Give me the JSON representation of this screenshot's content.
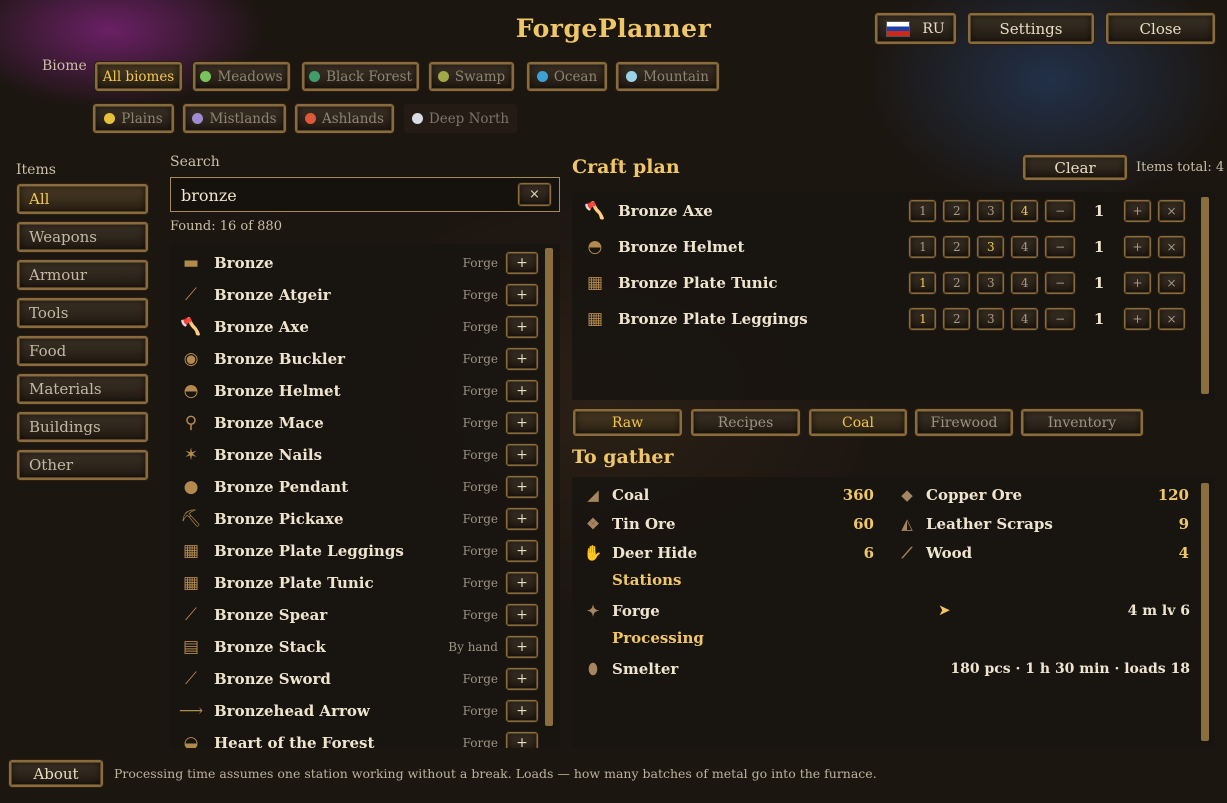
{
  "app": {
    "title": "ForgePlanner"
  },
  "header": {
    "language": "RU",
    "settings": "Settings",
    "close": "Close"
  },
  "biome": {
    "label": "Biome",
    "options": [
      {
        "label": "All biomes",
        "color": ""
      },
      {
        "label": "Meadows",
        "color": "#7ac35a"
      },
      {
        "label": "Black Forest",
        "color": "#3f9e6a"
      },
      {
        "label": "Swamp",
        "color": "#a2a84a"
      },
      {
        "label": "Ocean",
        "color": "#3fa0d6"
      },
      {
        "label": "Mountain",
        "color": "#9cd2e6"
      },
      {
        "label": "Plains",
        "color": "#e8c13a"
      },
      {
        "label": "Mistlands",
        "color": "#a08ad0"
      },
      {
        "label": "Ashlands",
        "color": "#e0583a"
      },
      {
        "label": "Deep North",
        "color": "#d8dde4"
      }
    ]
  },
  "categories": {
    "label": "Items",
    "items": [
      "All",
      "Weapons",
      "Armour",
      "Tools",
      "Food",
      "Materials",
      "Buildings",
      "Other"
    ]
  },
  "search": {
    "label": "Search",
    "value": "bronze",
    "clear": "×",
    "found": "Found: 16 of 880"
  },
  "items": [
    {
      "name": "Bronze",
      "station": "Forge",
      "icon": "ingot-icon",
      "glyph": "▬"
    },
    {
      "name": "Bronze Atgeir",
      "station": "Forge",
      "icon": "atgeir-icon",
      "glyph": "⟋"
    },
    {
      "name": "Bronze Axe",
      "station": "Forge",
      "icon": "axe-icon",
      "glyph": "🪓"
    },
    {
      "name": "Bronze Buckler",
      "station": "Forge",
      "icon": "buckler-icon",
      "glyph": "◉"
    },
    {
      "name": "Bronze Helmet",
      "station": "Forge",
      "icon": "helmet-icon",
      "glyph": "◓"
    },
    {
      "name": "Bronze Mace",
      "station": "Forge",
      "icon": "mace-icon",
      "glyph": "⚲"
    },
    {
      "name": "Bronze Nails",
      "station": "Forge",
      "icon": "nails-icon",
      "glyph": "✶"
    },
    {
      "name": "Bronze Pendant",
      "station": "Forge",
      "icon": "pendant-icon",
      "glyph": "●"
    },
    {
      "name": "Bronze Pickaxe",
      "station": "Forge",
      "icon": "pickaxe-icon",
      "glyph": "⛏"
    },
    {
      "name": "Bronze Plate Leggings",
      "station": "Forge",
      "icon": "leggings-icon",
      "glyph": "▦"
    },
    {
      "name": "Bronze Plate Tunic",
      "station": "Forge",
      "icon": "tunic-icon",
      "glyph": "▦"
    },
    {
      "name": "Bronze Spear",
      "station": "Forge",
      "icon": "spear-icon",
      "glyph": "⟋"
    },
    {
      "name": "Bronze Stack",
      "station": "By hand",
      "icon": "stack-icon",
      "glyph": "▤"
    },
    {
      "name": "Bronze Sword",
      "station": "Forge",
      "icon": "sword-icon",
      "glyph": "⟋"
    },
    {
      "name": "Bronzehead Arrow",
      "station": "Forge",
      "icon": "arrow-icon",
      "glyph": "⟶"
    },
    {
      "name": "Heart of the Forest",
      "station": "Forge",
      "icon": "heart-icon",
      "glyph": "◒"
    }
  ],
  "plan": {
    "title": "Craft plan",
    "clear": "Clear",
    "total": "Items total: 4",
    "rows": [
      {
        "name": "Bronze Axe",
        "icon": "axe-icon",
        "glyph": "🪓",
        "level": 4,
        "qty": "1"
      },
      {
        "name": "Bronze Helmet",
        "icon": "helmet-icon",
        "glyph": "◓",
        "level": 3,
        "qty": "1"
      },
      {
        "name": "Bronze Plate Tunic",
        "icon": "tunic-icon",
        "glyph": "▦",
        "level": 1,
        "qty": "1"
      },
      {
        "name": "Bronze Plate Leggings",
        "icon": "leggings-icon",
        "glyph": "▦",
        "level": 1,
        "qty": "1"
      }
    ],
    "levels": [
      "1",
      "2",
      "3",
      "4"
    ],
    "minus": "−",
    "plus": "+",
    "remove": "×"
  },
  "tabs": [
    {
      "label": "Raw",
      "active": true
    },
    {
      "label": "Recipes",
      "active": false
    },
    {
      "label": "Coal",
      "active": true
    },
    {
      "label": "Firewood",
      "active": false
    },
    {
      "label": "Inventory",
      "active": false
    }
  ],
  "gather": {
    "title": "To gather",
    "left": [
      {
        "name": "Coal",
        "value": "360",
        "icon": "coal-icon",
        "glyph": "◢"
      },
      {
        "name": "Tin Ore",
        "value": "60",
        "icon": "tin-ore-icon",
        "glyph": "❖"
      },
      {
        "name": "Deer Hide",
        "value": "6",
        "icon": "deer-hide-icon",
        "glyph": "✋"
      }
    ],
    "right": [
      {
        "name": "Copper Ore",
        "value": "120",
        "icon": "copper-ore-icon",
        "glyph": "◆"
      },
      {
        "name": "Leather Scraps",
        "value": "9",
        "icon": "leather-scraps-icon",
        "glyph": "◭"
      },
      {
        "name": "Wood",
        "value": "4",
        "icon": "wood-icon",
        "glyph": "⟋"
      }
    ],
    "stations_label": "Stations",
    "stations": [
      {
        "name": "Forge",
        "detail": "4 m  lv 6",
        "icon": "forge-icon",
        "glyph": "✦"
      }
    ],
    "processing_label": "Processing",
    "processing": [
      {
        "name": "Smelter",
        "detail": "180 pcs · 1 h 30 min · loads 18",
        "icon": "smelter-icon",
        "glyph": "⬮"
      }
    ]
  },
  "footer": {
    "about": "About",
    "note": "Processing time assumes one station working without a break. Loads — how many batches of metal go into the furnace."
  }
}
